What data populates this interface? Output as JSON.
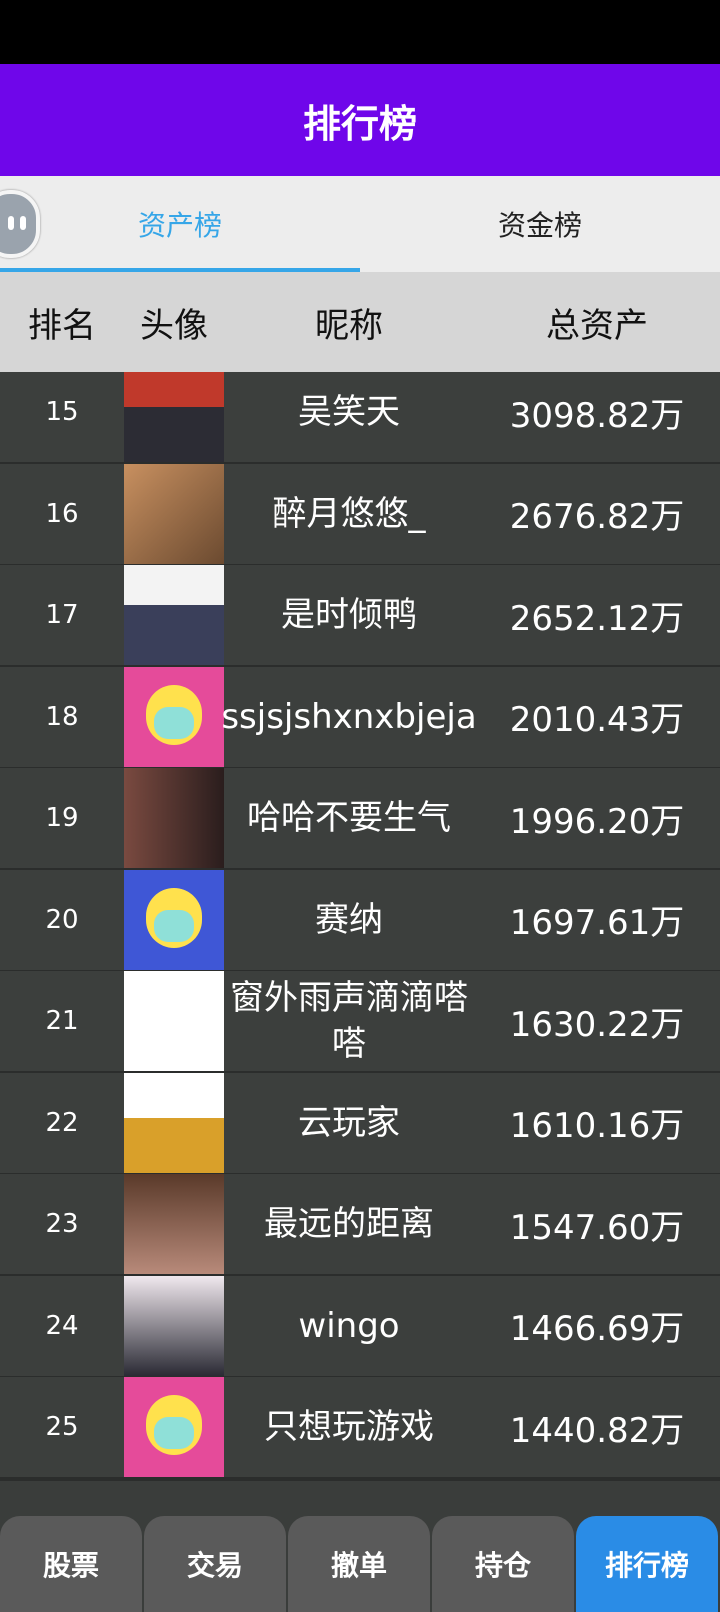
{
  "header": {
    "title": "排行榜"
  },
  "tabs": [
    {
      "label": "资产榜",
      "active": true
    },
    {
      "label": "资金榜",
      "active": false
    }
  ],
  "columns": [
    "排名",
    "头像",
    "昵称",
    "总资产"
  ],
  "rows": [
    {
      "rank": "15",
      "name": "吴笑天",
      "asset": "3098.82万",
      "avatar": "red-hair-character-avatar"
    },
    {
      "rank": "16",
      "name": "醉月悠悠_",
      "asset": "2676.82万",
      "avatar": "girl-back-view-avatar"
    },
    {
      "rank": "17",
      "name": "是时倾鸭",
      "asset": "2652.12万",
      "avatar": "anime-girl-uniform-avatar"
    },
    {
      "rank": "18",
      "name": "ssjsjshxnxbjeja",
      "asset": "2010.43万",
      "avatar": "default-cartoon-avatar-pink"
    },
    {
      "rank": "19",
      "name": "哈哈不要生气",
      "asset": "1996.20万",
      "avatar": "couple-photo-avatar"
    },
    {
      "rank": "20",
      "name": "赛纳",
      "asset": "1697.61万",
      "avatar": "default-cartoon-avatar-blue"
    },
    {
      "rank": "21",
      "name": "窗外雨声滴滴嗒嗒",
      "asset": "1630.22万",
      "avatar": "laughing-cartoon-avatar"
    },
    {
      "rank": "22",
      "name": "云玩家",
      "asset": "1610.16万",
      "avatar": "anime-girl-yellow-avatar"
    },
    {
      "rank": "23",
      "name": "最远的距离",
      "asset": "1547.60万",
      "avatar": "3d-girl-face-avatar"
    },
    {
      "rank": "24",
      "name": "wingo",
      "asset": "1466.69万",
      "avatar": "anime-white-hair-avatar"
    },
    {
      "rank": "25",
      "name": "只想玩游戏",
      "asset": "1440.82万",
      "avatar": "default-cartoon-avatar-pink"
    }
  ],
  "bottom_nav": [
    {
      "label": "股票",
      "active": false
    },
    {
      "label": "交易",
      "active": false
    },
    {
      "label": "撤单",
      "active": false
    },
    {
      "label": "持仓",
      "active": false
    },
    {
      "label": "排行榜",
      "active": true
    }
  ],
  "colors": {
    "header_bg": "#6f06ea",
    "tab_active": "#36a6e8",
    "nav_active": "#2a8ce6"
  }
}
